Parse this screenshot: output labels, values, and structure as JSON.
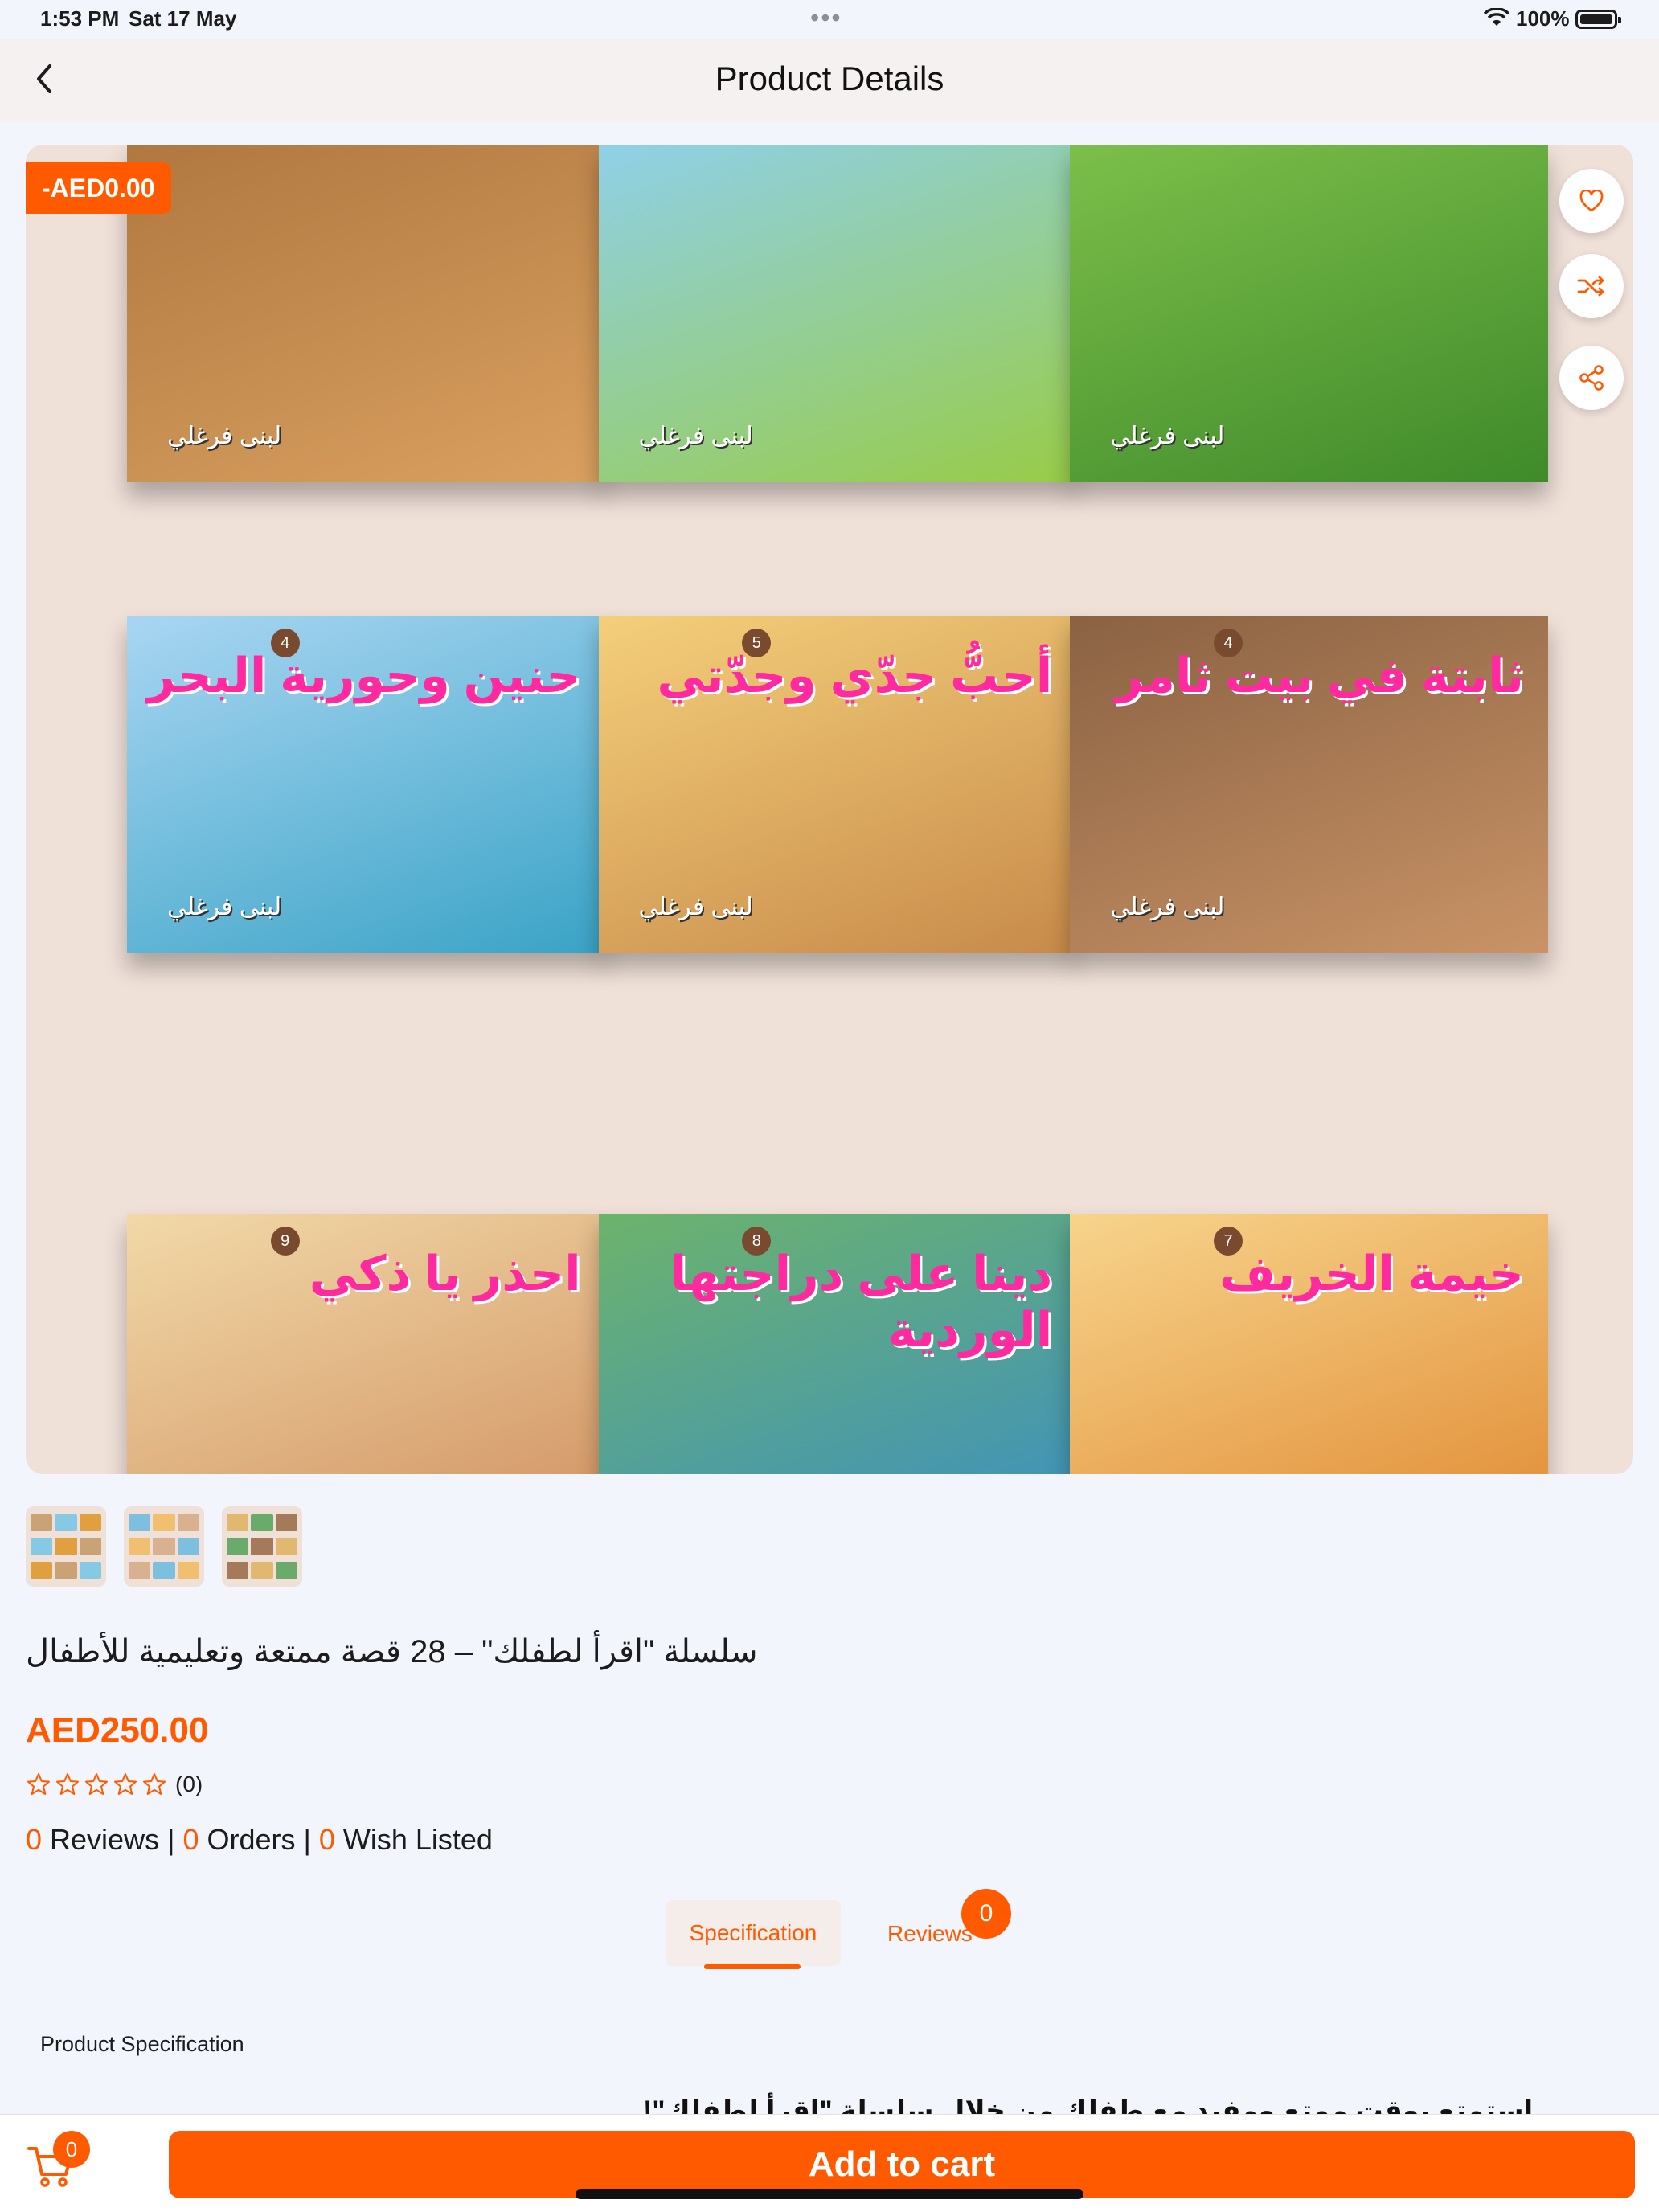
{
  "status_bar": {
    "time": "1:53 PM",
    "date": "Sat 17 May",
    "battery": "100%"
  },
  "nav": {
    "title": "Product Details"
  },
  "hero": {
    "discount_badge": "-AED0.00",
    "rows": [
      {
        "covers": [
          {
            "title": "",
            "author": "لبنى فرغلي",
            "colors": [
              "#b07840",
              "#d9a060"
            ]
          },
          {
            "title": "",
            "author": "لبنى فرغلي",
            "colors": [
              "#8fd0e8",
              "#98cc48"
            ]
          },
          {
            "title": "",
            "author": "لبنى فرغلي",
            "colors": [
              "#7cbf4a",
              "#3f8a2a"
            ]
          }
        ]
      },
      {
        "covers": [
          {
            "number": "4",
            "title": "حنين وحورية البحر",
            "author": "لبنى فرغلي",
            "colors": [
              "#a9d6f2",
              "#3aa3c6"
            ]
          },
          {
            "number": "5",
            "title": "أحبُّ جدّي وجدّتي",
            "author": "لبنى فرغلي",
            "colors": [
              "#f4cf7a",
              "#c78a4a"
            ]
          },
          {
            "number": "4",
            "title": "ثابتة في بيت ثامر",
            "author": "لبنى فرغلي",
            "colors": [
              "#8a6243",
              "#c99366"
            ]
          }
        ]
      },
      {
        "covers": [
          {
            "number": "9",
            "title": "احذر يا ذكي",
            "author": "",
            "colors": [
              "#f2d9a8",
              "#d09060"
            ]
          },
          {
            "number": "8",
            "title": "دينا على دراجتها الوردية",
            "author": "",
            "colors": [
              "#6db36c",
              "#3b8fc2"
            ]
          },
          {
            "number": "7",
            "title": "خيمة الخريف",
            "author": "",
            "colors": [
              "#f7d48c",
              "#e08a32"
            ]
          }
        ]
      }
    ]
  },
  "thumbnails": [
    {
      "colors": [
        "#c9a276",
        "#86c9e4",
        "#e0a040"
      ]
    },
    {
      "colors": [
        "#7cbfdf",
        "#f0c070",
        "#d9b090"
      ]
    },
    {
      "colors": [
        "#e0b870",
        "#6aaa6a",
        "#a57a5a"
      ]
    }
  ],
  "product": {
    "title": "سلسلة \"اقرأ لطفلك\" – 28 قصة ممتعة وتعليمية للأطفال",
    "price": "AED250.00",
    "rating_count": "(0)",
    "stats": {
      "reviews_count": "0",
      "reviews_label": " Reviews | ",
      "orders_count": "0",
      "orders_label": " Orders | ",
      "wish_count": "0",
      "wish_label": " Wish Listed"
    }
  },
  "tabs": {
    "specification": "Specification",
    "reviews": "Reviews",
    "reviews_badge": "0"
  },
  "specification": {
    "heading": "Product Specification",
    "text": "استمتع بوقت ممتع ومفيد مع طفلك من خلال سلسلة \"اقرأ لطفلك\"!"
  },
  "bottom_bar": {
    "cart_count": "0",
    "add_to_cart": "Add to cart"
  },
  "colors": {
    "accent": "#ff5a00",
    "hero_bg": "#efe0d8",
    "page_bg": "#f2f5fb"
  }
}
